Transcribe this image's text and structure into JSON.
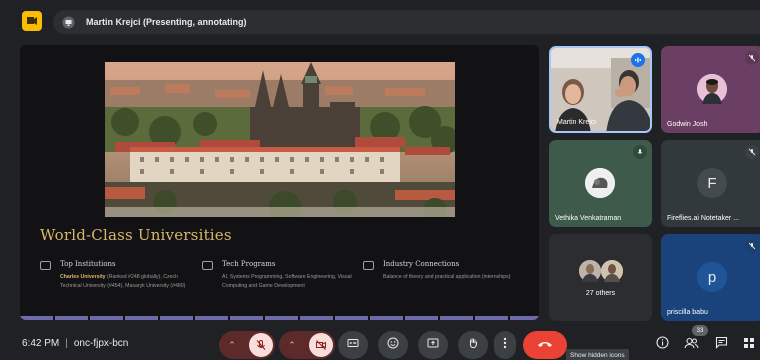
{
  "presenter_bar": {
    "name": "Martin Krejci (Presenting, annotating)"
  },
  "slide": {
    "title": "World-Class Universities",
    "columns": [
      {
        "heading": "Top Institutions",
        "highlight": "Charles University",
        "body": " (Ranked #248 globally), Czech Technical University (#454), Masaryk University (#480)"
      },
      {
        "heading": "Tech Programs",
        "highlight": "",
        "body": "AI, Systems Programming, Software Engineering, Visual Computing and Game Development"
      },
      {
        "heading": "Industry Connections",
        "highlight": "",
        "body": "Balance of theory and practical application (internships)"
      }
    ]
  },
  "participants": [
    {
      "name": "Martin Krejci",
      "speaking": true
    },
    {
      "name": "Godwin Josh",
      "muted": true
    },
    {
      "name": "Vethika Venkatraman",
      "muted": false
    },
    {
      "name": "Fireflies.ai Notetaker ...",
      "initial": "F",
      "muted": true
    },
    {
      "name": "27 others"
    },
    {
      "name": "priscilla babu",
      "initial": "p",
      "muted": true
    }
  ],
  "footer": {
    "time": "6:42 PM",
    "separator": "|",
    "meeting_code": "onc-fjpx-bcn",
    "people_count": "33",
    "tooltip": "Show hidden icons"
  },
  "colors": {
    "accent_gold": "#d9b76a",
    "end_call": "#ea4335",
    "app_logo": "#fbbc04",
    "muted_red": "#5c2b29"
  }
}
